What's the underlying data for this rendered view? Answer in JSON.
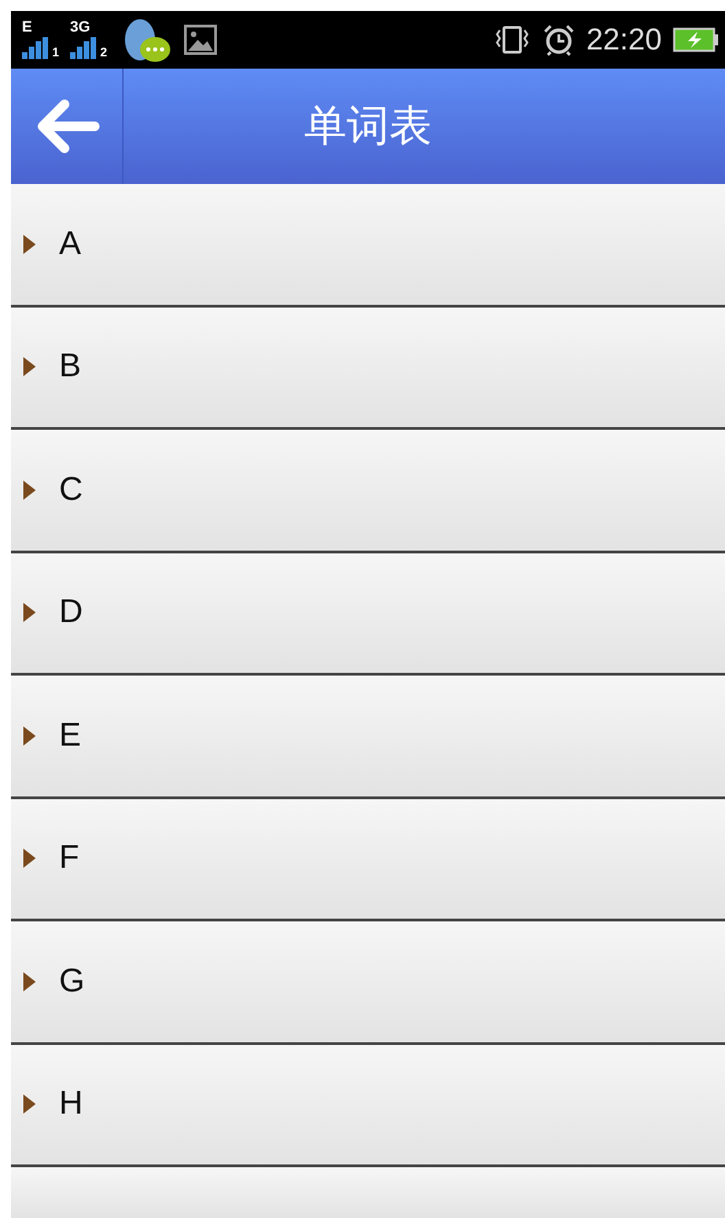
{
  "status_bar": {
    "sim1_network": "E",
    "sim1_slot": "1",
    "sim2_network": "3G",
    "sim2_slot": "2",
    "time": "22:20"
  },
  "header": {
    "title": "单词表"
  },
  "groups": [
    {
      "label": "A",
      "expanded": false
    },
    {
      "label": "B",
      "expanded": false
    },
    {
      "label": "C",
      "expanded": false
    },
    {
      "label": "D",
      "expanded": false
    },
    {
      "label": "E",
      "expanded": false
    },
    {
      "label": "F",
      "expanded": false
    },
    {
      "label": "G",
      "expanded": false
    },
    {
      "label": "H",
      "expanded": false
    }
  ]
}
